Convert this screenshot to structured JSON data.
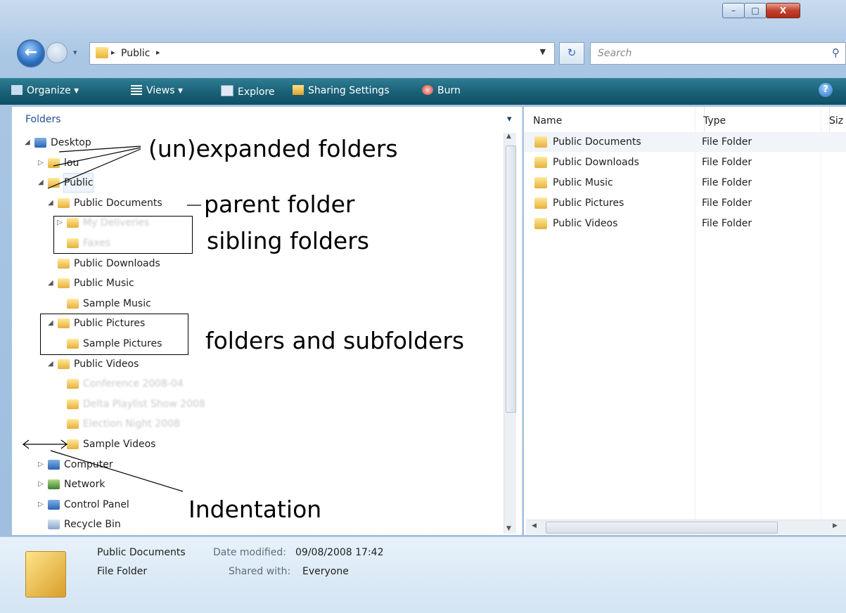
{
  "window": {
    "controls": {
      "minimize": "–",
      "maximize": "□",
      "close": "X"
    }
  },
  "nav": {
    "back_icon": "back-arrow-icon",
    "history_dropdown": "▾",
    "address_segment": "Public",
    "search_placeholder": "Search"
  },
  "toolbar": {
    "organize": "Organize",
    "views": "Views",
    "explore": "Explore",
    "sharing": "Sharing Settings",
    "burn": "Burn",
    "help": "?"
  },
  "left": {
    "header": "Folders",
    "tree": [
      {
        "label": "Desktop",
        "level": 0,
        "state": "expanded"
      },
      {
        "label": "lou",
        "level": 1,
        "state": "collapsed"
      },
      {
        "label": "Public",
        "level": 1,
        "state": "expanded"
      },
      {
        "label": "Public Documents",
        "level": 2,
        "state": "expanded"
      },
      {
        "label": "My Deliveries",
        "level": 3,
        "state": "collapsed",
        "blurred": true
      },
      {
        "label": "Faxes",
        "level": 3,
        "state": "none",
        "blurred": true
      },
      {
        "label": "Public Downloads",
        "level": 2,
        "state": "none"
      },
      {
        "label": "Public Music",
        "level": 2,
        "state": "expanded"
      },
      {
        "label": "Sample Music",
        "level": 3,
        "state": "none"
      },
      {
        "label": "Public Pictures",
        "level": 2,
        "state": "expanded"
      },
      {
        "label": "Sample Pictures",
        "level": 3,
        "state": "none"
      },
      {
        "label": "Public Videos",
        "level": 2,
        "state": "expanded"
      },
      {
        "label": "Conference 2008-04",
        "level": 3,
        "state": "none",
        "blurred": true
      },
      {
        "label": "Delta Playlist Show 2008",
        "level": 3,
        "state": "none",
        "blurred": true
      },
      {
        "label": "Election Night 2008",
        "level": 3,
        "state": "none",
        "blurred": true
      },
      {
        "label": "Sample Videos",
        "level": 3,
        "state": "none"
      },
      {
        "label": "Computer",
        "level": 1,
        "state": "collapsed"
      },
      {
        "label": "Network",
        "level": 1,
        "state": "collapsed"
      },
      {
        "label": "Control Panel",
        "level": 1,
        "state": "collapsed"
      },
      {
        "label": "Recycle Bin",
        "level": 1,
        "state": "none"
      }
    ]
  },
  "right": {
    "columns": {
      "name": "Name",
      "type": "Type",
      "size": "Siz"
    },
    "rows": [
      {
        "name": "Public Documents",
        "type": "File Folder"
      },
      {
        "name": "Public Downloads",
        "type": "File Folder"
      },
      {
        "name": "Public Music",
        "type": "File Folder"
      },
      {
        "name": "Public Pictures",
        "type": "File Folder"
      },
      {
        "name": "Public Videos",
        "type": "File Folder"
      }
    ]
  },
  "details": {
    "name": "Public Documents",
    "kind": "File Folder",
    "modified_label": "Date modified:",
    "modified_value": "09/08/2008 17:42",
    "shared_label": "Shared with:",
    "shared_value": "Everyone"
  },
  "annotations": {
    "expanded": "(un)expanded folders",
    "parent": "parent folder",
    "sibling": "sibling folders",
    "subfolders": "folders and subfolders",
    "indentation": "Indentation"
  },
  "colors": {
    "toolbar": "#1b6277",
    "folders_header": "#1f4f93",
    "details_bg": "#e7f1fa"
  }
}
